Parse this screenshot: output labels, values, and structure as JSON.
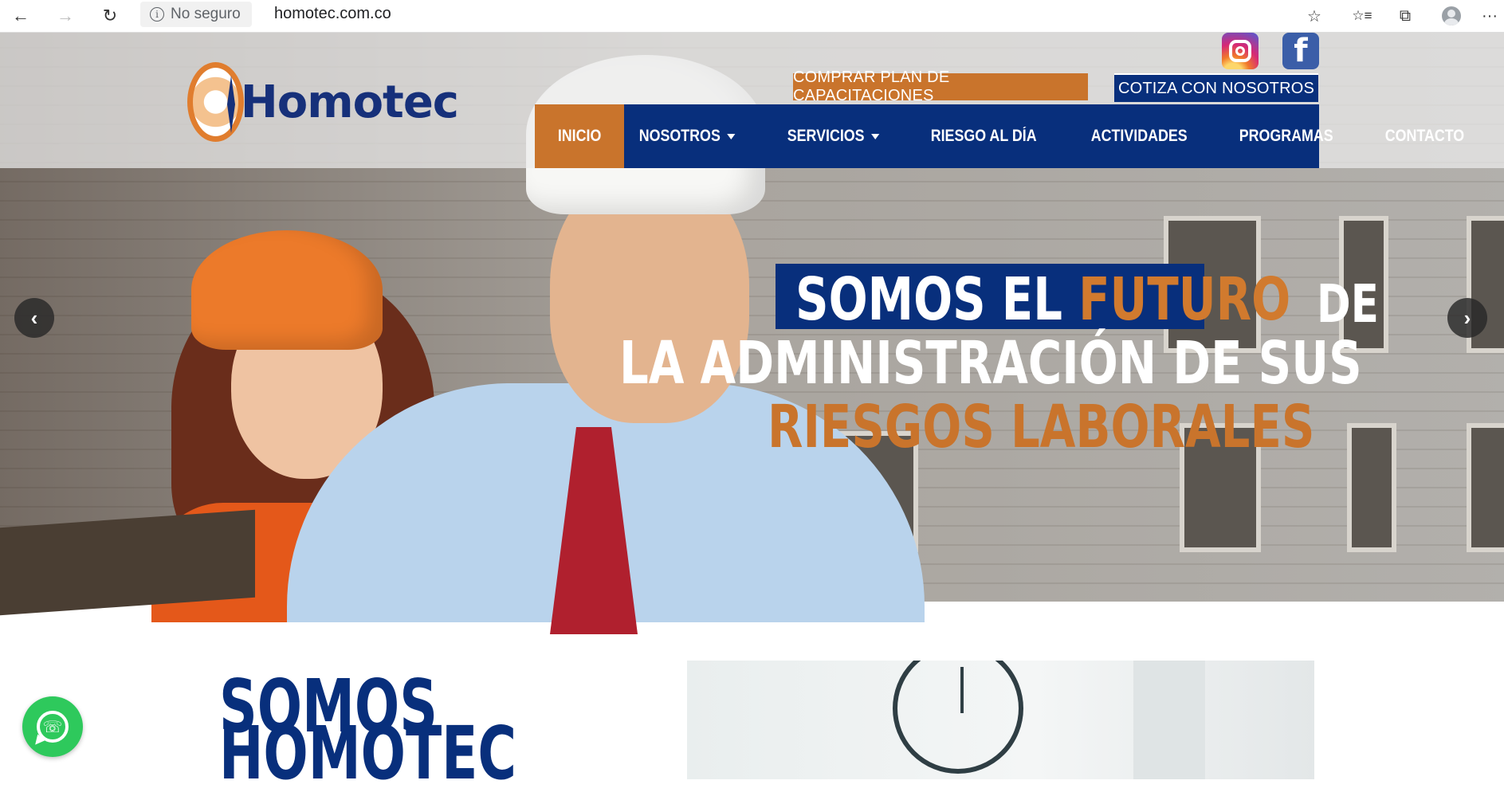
{
  "browser": {
    "back_icon": "←",
    "forward_icon": "→",
    "reload_icon": "↻",
    "security_label": "No seguro",
    "url": "homotec.com.co",
    "star_icon": "☆",
    "favorites_icon": "☆≡",
    "collections_icon": "⧉",
    "more_icon": "···"
  },
  "site": {
    "logo_text": "Homotec",
    "social": {
      "facebook_glyph": "f"
    },
    "cta": {
      "buy_plan": "COMPRAR PLAN DE CAPACITACIONES",
      "quote": "COTIZA CON NOSOTROS"
    },
    "nav": {
      "items": [
        {
          "label": "INICIO",
          "active": true
        },
        {
          "label": "NOSOTROS",
          "dropdown": true
        },
        {
          "label": "SERVICIOS",
          "dropdown": true
        },
        {
          "label": "RIESGO AL DÍA"
        },
        {
          "label": "ACTIVIDADES"
        },
        {
          "label": "PROGRAMAS"
        },
        {
          "label": "CONTACTO"
        }
      ]
    },
    "hero": {
      "line1_a": "SOMOS EL ",
      "line1_b": "FUTURO",
      "line1_c": "DE",
      "line2": "LA ADMINISTRACIÓN DE SUS",
      "line3": "RIESGOS LABORALES",
      "prev_icon": "‹",
      "next_icon": "›"
    },
    "about": {
      "title_line1": "SOMOS",
      "title_line2": "HOMOTEC"
    },
    "colors": {
      "brand_blue": "#082f7c",
      "brand_orange": "#c9742c",
      "whatsapp_green": "#2ec95c"
    }
  }
}
